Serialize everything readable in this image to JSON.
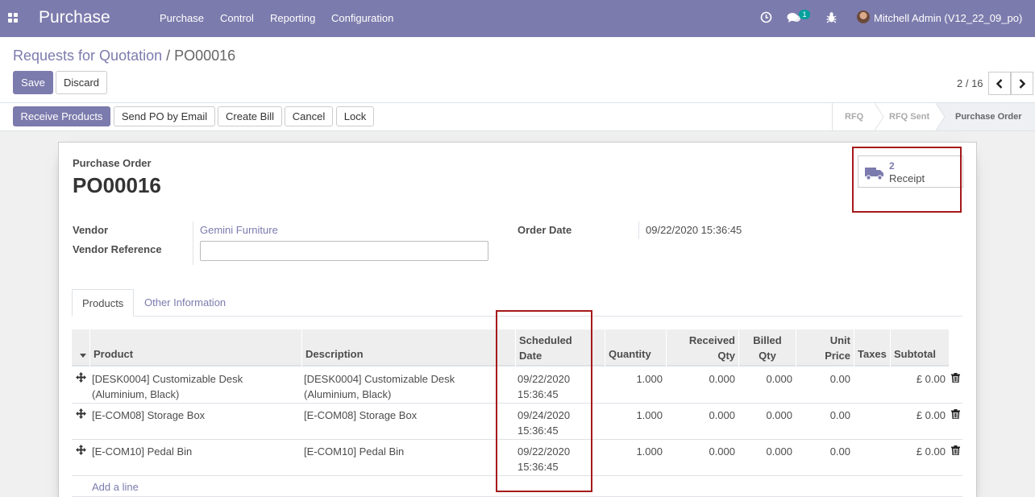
{
  "app": {
    "name": "Purchase",
    "menu": [
      "Purchase",
      "Control",
      "Reporting",
      "Configuration"
    ],
    "chat_badge": "1",
    "user": "Mitchell Admin (V12_22_09_po)"
  },
  "breadcrumb": {
    "parent": "Requests for Quotation",
    "separator": "/",
    "current": "PO00016"
  },
  "actions": {
    "save": "Save",
    "discard": "Discard"
  },
  "pager": {
    "value": "2 / 16"
  },
  "statusbar": {
    "buttons": [
      "Receive Products",
      "Send PO by Email",
      "Create Bill",
      "Cancel",
      "Lock"
    ],
    "stages": [
      "RFQ",
      "RFQ Sent",
      "Purchase Order"
    ],
    "active_stage": "Purchase Order"
  },
  "form": {
    "doc_label": "Purchase Order",
    "name": "PO00016",
    "smart_button": {
      "count": "2",
      "label": "Receipt"
    },
    "vendor_label": "Vendor",
    "vendor": "Gemini Furniture",
    "vendor_ref_label": "Vendor Reference",
    "vendor_ref": "",
    "order_date_label": "Order Date",
    "order_date": "09/22/2020 15:36:45"
  },
  "tabs": [
    "Products",
    "Other Information"
  ],
  "table": {
    "headers": {
      "product": "Product",
      "description": "Description",
      "scheduled_1": "Scheduled",
      "scheduled_2": "Date",
      "quantity": "Quantity",
      "received_1": "Received",
      "received_2": "Qty",
      "billed_1": "Billed",
      "billed_2": "Qty",
      "unit_1": "Unit",
      "unit_2": "Price",
      "taxes": "Taxes",
      "subtotal": "Subtotal"
    },
    "rows": [
      {
        "product_1": "[DESK0004] Customizable Desk",
        "product_2": "(Aluminium, Black)",
        "desc_1": "[DESK0004] Customizable Desk",
        "desc_2": "(Aluminium, Black)",
        "date_1": "09/22/2020",
        "date_2": "15:36:45",
        "qty": "1.000",
        "received": "0.000",
        "billed": "0.000",
        "price": "0.00",
        "taxes": "",
        "subtotal": "£ 0.00"
      },
      {
        "product_1": "[E-COM08] Storage Box",
        "product_2": "",
        "desc_1": "[E-COM08] Storage Box",
        "desc_2": "",
        "date_1": "09/24/2020",
        "date_2": "15:36:45",
        "qty": "1.000",
        "received": "0.000",
        "billed": "0.000",
        "price": "0.00",
        "taxes": "",
        "subtotal": "£ 0.00"
      },
      {
        "product_1": "[E-COM10] Pedal Bin",
        "product_2": "",
        "desc_1": "[E-COM10] Pedal Bin",
        "desc_2": "",
        "date_1": "09/22/2020",
        "date_2": "15:36:45",
        "qty": "1.000",
        "received": "0.000",
        "billed": "0.000",
        "price": "0.00",
        "taxes": "",
        "subtotal": "£ 0.00"
      }
    ],
    "add_line": "Add a line"
  }
}
